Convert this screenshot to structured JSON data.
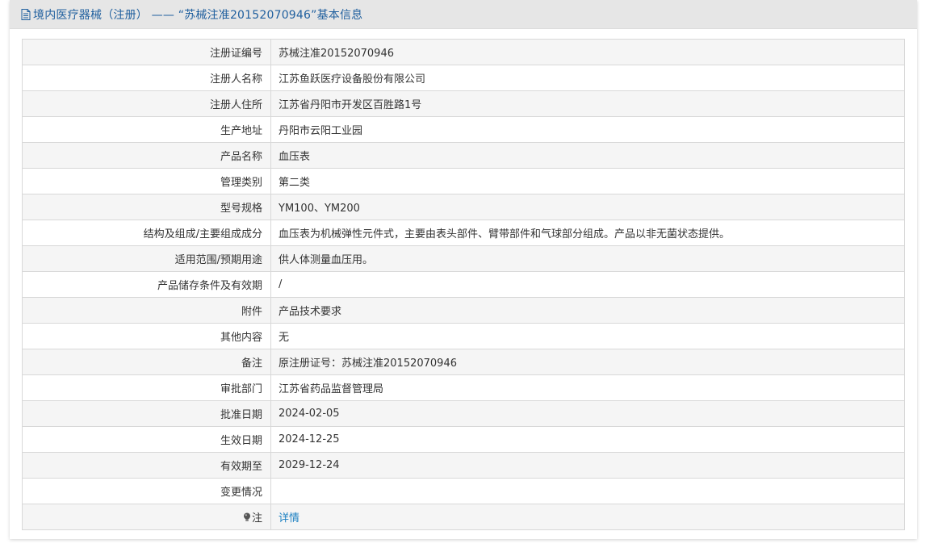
{
  "header": {
    "title": "境内医疗器械（注册） —— “苏械注准20152070946”基本信息"
  },
  "rows": [
    {
      "label": "注册证编号",
      "value": "苏械注准20152070946"
    },
    {
      "label": "注册人名称",
      "value": "江苏鱼跃医疗设备股份有限公司"
    },
    {
      "label": "注册人住所",
      "value": "江苏省丹阳市开发区百胜路1号"
    },
    {
      "label": "生产地址",
      "value": "丹阳市云阳工业园"
    },
    {
      "label": "产品名称",
      "value": "血压表"
    },
    {
      "label": "管理类别",
      "value": "第二类"
    },
    {
      "label": "型号规格",
      "value": "YM100、YM200"
    },
    {
      "label": "结构及组成/主要组成成分",
      "value": "血压表为机械弹性元件式，主要由表头部件、臂带部件和气球部分组成。产品以非无菌状态提供。"
    },
    {
      "label": "适用范围/预期用途",
      "value": "供人体测量血压用。"
    },
    {
      "label": "产品储存条件及有效期",
      "value": "/"
    },
    {
      "label": "附件",
      "value": "产品技术要求"
    },
    {
      "label": "其他内容",
      "value": "无"
    },
    {
      "label": "备注",
      "value": "原注册证号：苏械注准20152070946"
    },
    {
      "label": "审批部门",
      "value": "江苏省药品监督管理局"
    },
    {
      "label": "批准日期",
      "value": "2024-02-05"
    },
    {
      "label": "生效日期",
      "value": "2024-12-25"
    },
    {
      "label": "有效期至",
      "value": "2029-12-24"
    },
    {
      "label": "变更情况",
      "value": ""
    }
  ],
  "note_row": {
    "label": "注",
    "icon": "lightbulb-icon",
    "link_text": "详情"
  },
  "colors": {
    "title": "#1f5f9e",
    "link": "#1a7fc1",
    "header_bg": "#e6e6e6",
    "row_alt_bg": "#f5f5f5",
    "border": "#d8d8d8"
  }
}
